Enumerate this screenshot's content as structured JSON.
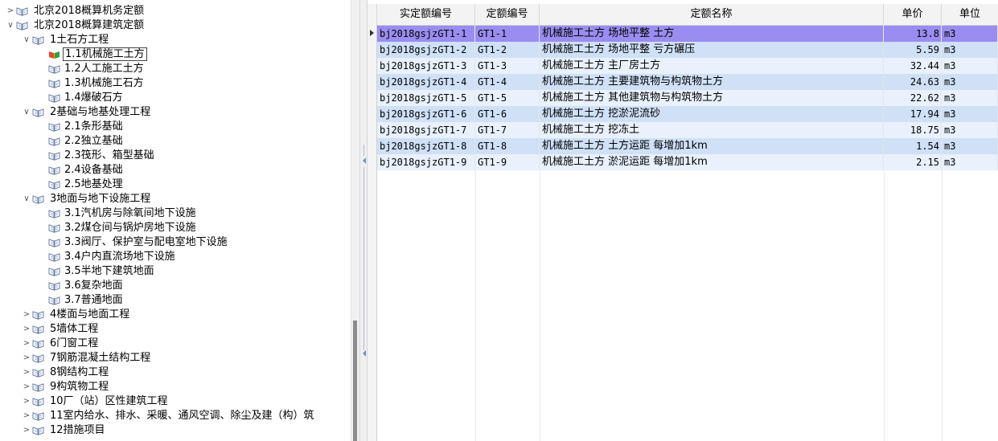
{
  "tree": {
    "nodes": [
      {
        "label": "北京2018概算机务定额",
        "level": 0,
        "toggle": ">",
        "selected": false
      },
      {
        "label": "北京2018概算建筑定额",
        "level": 0,
        "toggle": "∨",
        "selected": false
      },
      {
        "label": "1土石方工程",
        "level": 1,
        "toggle": "∨",
        "selected": false
      },
      {
        "label": "1.1机械施工土方",
        "level": 2,
        "toggle": "",
        "selected": true
      },
      {
        "label": "1.2人工施工土方",
        "level": 2,
        "toggle": "",
        "selected": false
      },
      {
        "label": "1.3机械施工石方",
        "level": 2,
        "toggle": "",
        "selected": false
      },
      {
        "label": "1.4爆破石方",
        "level": 2,
        "toggle": "",
        "selected": false
      },
      {
        "label": "2基础与地基处理工程",
        "level": 1,
        "toggle": "∨",
        "selected": false
      },
      {
        "label": "2.1条形基础",
        "level": 2,
        "toggle": "",
        "selected": false
      },
      {
        "label": "2.2独立基础",
        "level": 2,
        "toggle": "",
        "selected": false
      },
      {
        "label": "2.3筏形、箱型基础",
        "level": 2,
        "toggle": "",
        "selected": false
      },
      {
        "label": "2.4设备基础",
        "level": 2,
        "toggle": "",
        "selected": false
      },
      {
        "label": "2.5地基处理",
        "level": 2,
        "toggle": "",
        "selected": false
      },
      {
        "label": "3地面与地下设施工程",
        "level": 1,
        "toggle": "∨",
        "selected": false
      },
      {
        "label": "3.1汽机房与除氧间地下设施",
        "level": 2,
        "toggle": "",
        "selected": false
      },
      {
        "label": "3.2煤仓间与锅炉房地下设施",
        "level": 2,
        "toggle": "",
        "selected": false
      },
      {
        "label": "3.3阀厅、保护室与配电室地下设施",
        "level": 2,
        "toggle": "",
        "selected": false
      },
      {
        "label": "3.4户内直流场地下设施",
        "level": 2,
        "toggle": "",
        "selected": false
      },
      {
        "label": "3.5半地下建筑地面",
        "level": 2,
        "toggle": "",
        "selected": false
      },
      {
        "label": "3.6复杂地面",
        "level": 2,
        "toggle": "",
        "selected": false
      },
      {
        "label": "3.7普通地面",
        "level": 2,
        "toggle": "",
        "selected": false
      },
      {
        "label": "4楼面与地面工程",
        "level": 1,
        "toggle": ">",
        "selected": false
      },
      {
        "label": "5墙体工程",
        "level": 1,
        "toggle": ">",
        "selected": false
      },
      {
        "label": "6门窗工程",
        "level": 1,
        "toggle": ">",
        "selected": false
      },
      {
        "label": "7钢筋混凝土结构工程",
        "level": 1,
        "toggle": ">",
        "selected": false
      },
      {
        "label": "8钢结构工程",
        "level": 1,
        "toggle": ">",
        "selected": false
      },
      {
        "label": "9构筑物工程",
        "level": 1,
        "toggle": ">",
        "selected": false
      },
      {
        "label": "10厂（站）区性建筑工程",
        "level": 1,
        "toggle": ">",
        "selected": false
      },
      {
        "label": "11室内给水、排水、采暖、通风空调、除尘及建（构）筑",
        "level": 1,
        "toggle": ">",
        "selected": false
      },
      {
        "label": "12措施项目",
        "level": 1,
        "toggle": ">",
        "selected": false
      }
    ]
  },
  "grid": {
    "headers": [
      "实定额编号",
      "定额编号",
      "定额名称",
      "单价",
      "单位"
    ],
    "rows": [
      {
        "code_full": "bj2018gsjzGT1-1",
        "code": "GT1-1",
        "name": "机械施工土方 场地平整 土方",
        "price": "13.8",
        "unit": "m3"
      },
      {
        "code_full": "bj2018gsjzGT1-2",
        "code": "GT1-2",
        "name": "机械施工土方 场地平整 亏方碾压",
        "price": "5.59",
        "unit": "m3"
      },
      {
        "code_full": "bj2018gsjzGT1-3",
        "code": "GT1-3",
        "name": "机械施工土方 主厂房土方",
        "price": "32.44",
        "unit": "m3"
      },
      {
        "code_full": "bj2018gsjzGT1-4",
        "code": "GT1-4",
        "name": "机械施工土方 主要建筑物与构筑物土方",
        "price": "24.63",
        "unit": "m3"
      },
      {
        "code_full": "bj2018gsjzGT1-5",
        "code": "GT1-5",
        "name": "机械施工土方 其他建筑物与构筑物土方",
        "price": "22.62",
        "unit": "m3"
      },
      {
        "code_full": "bj2018gsjzGT1-6",
        "code": "GT1-6",
        "name": "机械施工土方 挖淤泥流砂",
        "price": "17.94",
        "unit": "m3"
      },
      {
        "code_full": "bj2018gsjzGT1-7",
        "code": "GT1-7",
        "name": "机械施工土方 挖冻土",
        "price": "18.75",
        "unit": "m3"
      },
      {
        "code_full": "bj2018gsjzGT1-8",
        "code": "GT1-8",
        "name": "机械施工土方 土方运距 每增加1km",
        "price": "1.54",
        "unit": "m3"
      },
      {
        "code_full": "bj2018gsjzGT1-9",
        "code": "GT1-9",
        "name": "机械施工土方 淤泥运距 每增加1km",
        "price": "2.15",
        "unit": "m3"
      }
    ]
  },
  "colors": {
    "selected_row": "#9a8cf0",
    "row_alt_dark": "#cfe0f7",
    "row_alt_light": "#e8f1fc"
  },
  "icons": {
    "tree_node": "book-icon",
    "tree_node_selected": "colored-book-icon"
  }
}
